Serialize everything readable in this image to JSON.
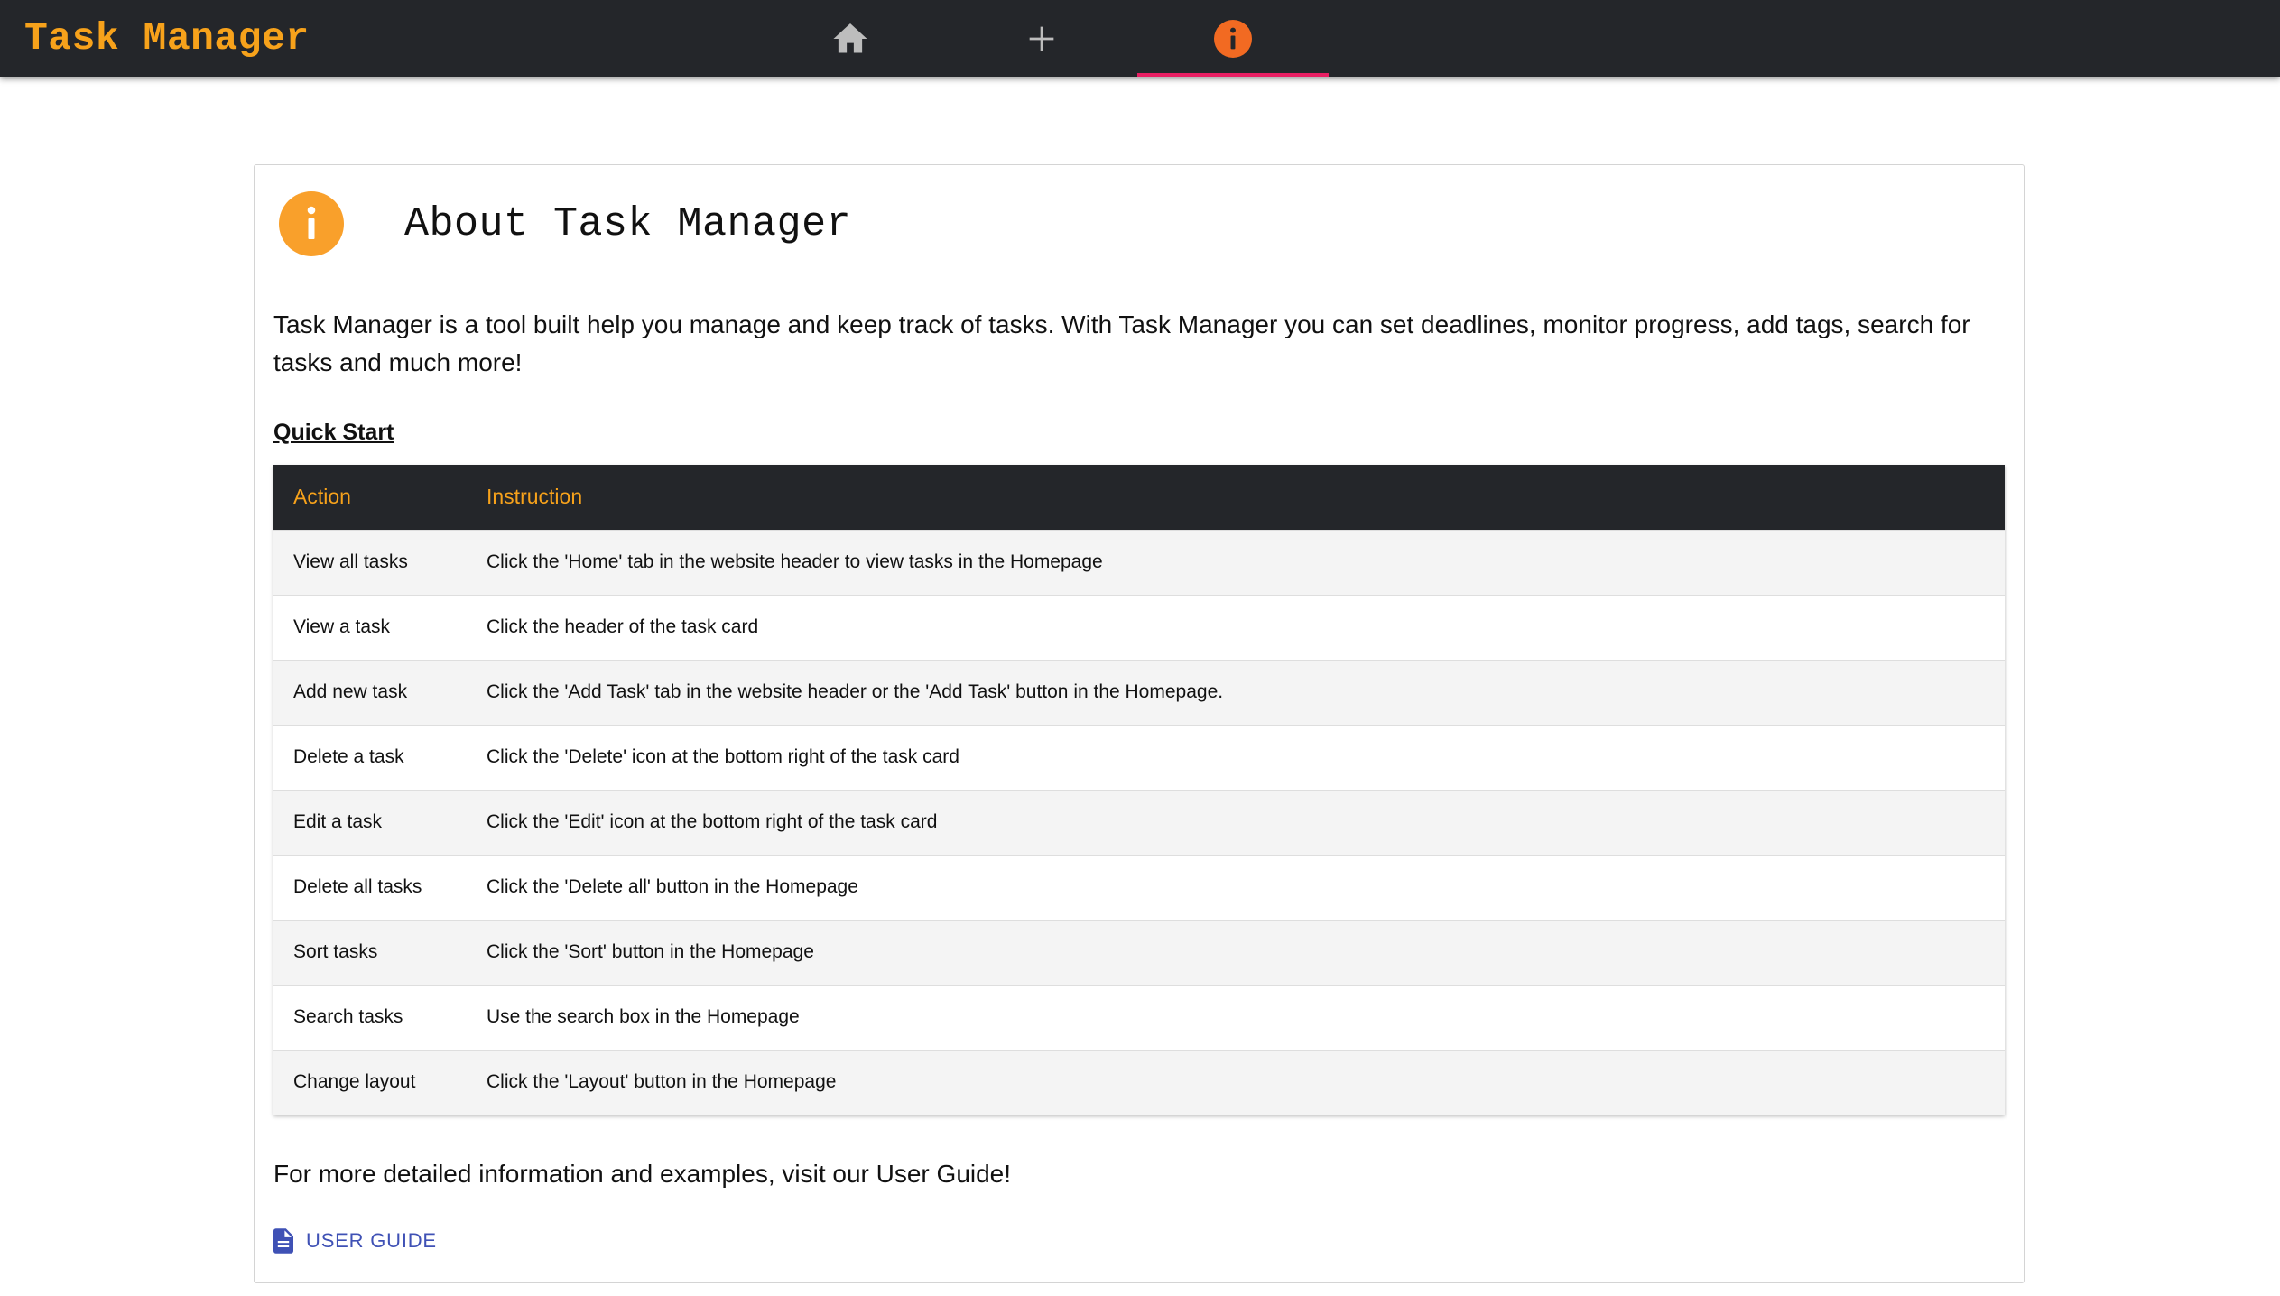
{
  "header": {
    "brand": "Task Manager",
    "tabs": [
      {
        "icon": "home-icon",
        "active": false
      },
      {
        "icon": "plus-icon",
        "active": false
      },
      {
        "icon": "info-icon",
        "active": true
      }
    ],
    "colors": {
      "bar": "#24262a",
      "brand": "#f7a21b",
      "active_indicator": "#e91e63",
      "active_icon": "#f26a22",
      "inactive_icon": "#bdbdbd"
    }
  },
  "about": {
    "icon": "info-icon",
    "icon_color": "#f9a02b",
    "title": "About Task Manager",
    "intro": "Task Manager is a tool built help you manage and keep track of tasks. With Task Manager you can set deadlines, monitor progress, add tags, search for tasks and much more!",
    "quick_start_heading": "Quick Start",
    "table": {
      "headers": [
        "Action",
        "Instruction"
      ],
      "rows": [
        {
          "action": "View all tasks",
          "instruction": "Click the 'Home' tab in the website header to view tasks in the Homepage"
        },
        {
          "action": "View a task",
          "instruction": "Click the header of the task card"
        },
        {
          "action": "Add new task",
          "instruction": "Click the 'Add Task' tab in the website header or the 'Add Task' button in the Homepage."
        },
        {
          "action": "Delete a task",
          "instruction": "Click the 'Delete' icon at the bottom right of the task card"
        },
        {
          "action": "Edit a task",
          "instruction": "Click the 'Edit' icon at the bottom right of the task card"
        },
        {
          "action": "Delete all tasks",
          "instruction": "Click the 'Delete all' button in the Homepage"
        },
        {
          "action": "Sort tasks",
          "instruction": "Click the 'Sort' button in the Homepage"
        },
        {
          "action": "Search tasks",
          "instruction": "Use the search box in the Homepage"
        },
        {
          "action": "Change layout",
          "instruction": "Click the 'Layout' button in the Homepage"
        }
      ]
    },
    "more_info": "For more detailed information and examples, visit our User Guide!",
    "guide_link": {
      "icon": "document-icon",
      "label": "User Guide",
      "color": "#3f51b5"
    }
  }
}
